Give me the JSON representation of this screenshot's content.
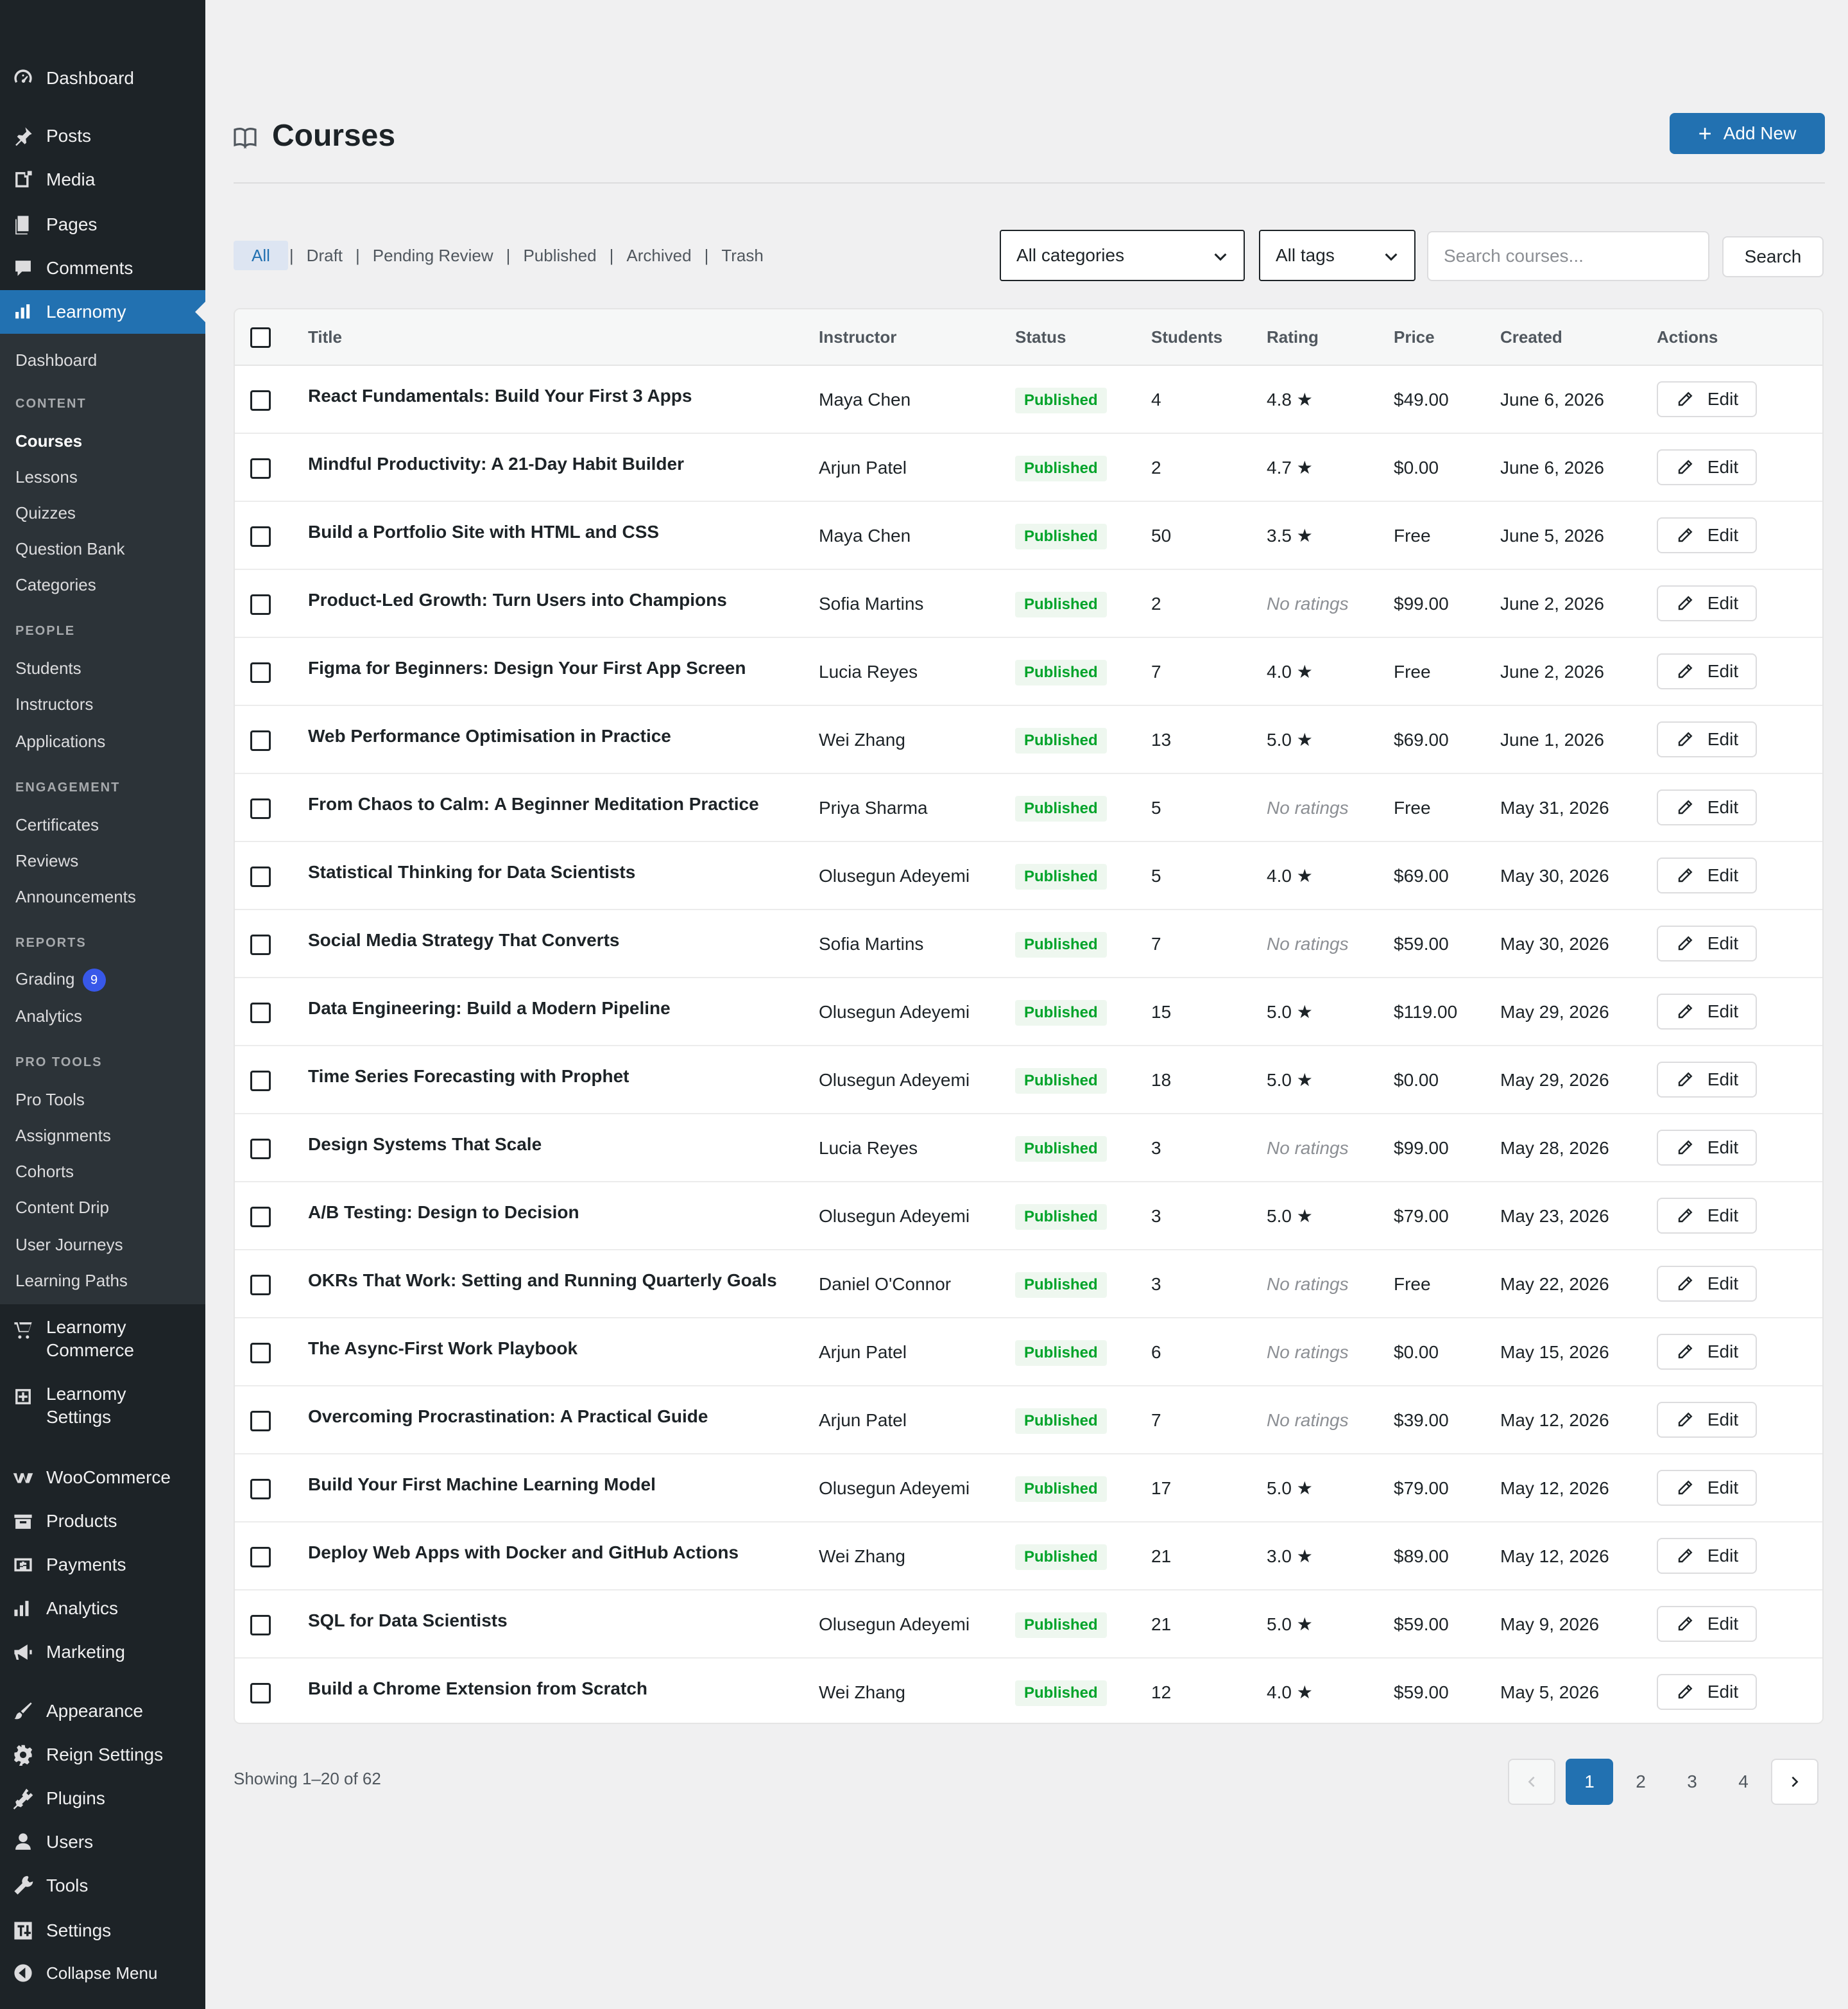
{
  "sidebar": {
    "top_items": [
      {
        "label": "Dashboard",
        "icon": "dashboard-icon"
      },
      {
        "label": "Posts",
        "icon": "pin-icon"
      },
      {
        "label": "Media",
        "icon": "media-icon"
      },
      {
        "label": "Pages",
        "icon": "pages-icon"
      },
      {
        "label": "Comments",
        "icon": "comment-icon"
      }
    ],
    "active_item": {
      "label": "Learnomy",
      "icon": "chart-icon"
    },
    "submenu": {
      "dashboard": "Dashboard",
      "sections": [
        {
          "heading": "CONTENT",
          "items": [
            "Courses",
            "Lessons",
            "Quizzes",
            "Question Bank",
            "Categories"
          ]
        },
        {
          "heading": "PEOPLE",
          "items": [
            "Students",
            "Instructors",
            "Applications"
          ]
        },
        {
          "heading": "ENGAGEMENT",
          "items": [
            "Certificates",
            "Reviews",
            "Announcements"
          ]
        },
        {
          "heading": "REPORTS",
          "items": [
            "Grading",
            "Analytics"
          ]
        },
        {
          "heading": "PRO TOOLS",
          "items": [
            "Pro Tools",
            "Assignments",
            "Cohorts",
            "Content Drip",
            "User Journeys",
            "Learning Paths"
          ]
        }
      ],
      "grading_badge": "9"
    },
    "bottom_items": [
      {
        "label": "Learnomy Commerce",
        "line1": "Learnomy",
        "line2": "Commerce",
        "icon": "cart-icon"
      },
      {
        "label": "Learnomy Settings",
        "line1": "Learnomy",
        "line2": "Settings",
        "icon": "settings-plus-icon"
      },
      {
        "label": "WooCommerce",
        "icon": "woo-icon"
      },
      {
        "label": "Products",
        "icon": "products-icon"
      },
      {
        "label": "Payments",
        "icon": "payments-icon"
      },
      {
        "label": "Analytics",
        "icon": "bar-chart-icon"
      },
      {
        "label": "Marketing",
        "icon": "megaphone-icon"
      },
      {
        "label": "Appearance",
        "icon": "brush-icon"
      },
      {
        "label": "Reign Settings",
        "icon": "gear-icon"
      },
      {
        "label": "Plugins",
        "icon": "plug-icon"
      },
      {
        "label": "Users",
        "icon": "user-icon"
      },
      {
        "label": "Tools",
        "icon": "wrench-icon"
      },
      {
        "label": "Settings",
        "icon": "sliders-icon"
      },
      {
        "label": "Collapse Menu",
        "icon": "collapse-icon"
      }
    ]
  },
  "header": {
    "title": "Courses",
    "add_new": "Add New"
  },
  "filters": {
    "views": [
      "All",
      "Draft",
      "Pending Review",
      "Published",
      "Archived",
      "Trash"
    ],
    "selected_view": "All",
    "category": "All categories",
    "tag": "All tags",
    "search_placeholder": "Search courses...",
    "search_button": "Search"
  },
  "table": {
    "columns": [
      "Title",
      "Instructor",
      "Status",
      "Students",
      "Rating",
      "Price",
      "Created",
      "Actions"
    ],
    "edit_label": "Edit",
    "rows": [
      {
        "title": "React Fundamentals: Build Your First 3 Apps",
        "instructor": "Maya Chen",
        "status": "Published",
        "students": "4",
        "rating": "4.8",
        "price": "$49.00",
        "created": "June 6, 2026"
      },
      {
        "title": "Mindful Productivity: A 21-Day Habit Builder",
        "instructor": "Arjun Patel",
        "status": "Published",
        "students": "2",
        "rating": "4.7",
        "price": "$0.00",
        "created": "June 6, 2026"
      },
      {
        "title": "Build a Portfolio Site with HTML and CSS",
        "instructor": "Maya Chen",
        "status": "Published",
        "students": "50",
        "rating": "3.5",
        "price": "Free",
        "created": "June 5, 2026"
      },
      {
        "title": "Product-Led Growth: Turn Users into Champions",
        "instructor": "Sofia Martins",
        "status": "Published",
        "students": "2",
        "rating": "No ratings",
        "price": "$99.00",
        "created": "June 2, 2026"
      },
      {
        "title": "Figma for Beginners: Design Your First App Screen",
        "instructor": "Lucia Reyes",
        "status": "Published",
        "students": "7",
        "rating": "4.0",
        "price": "Free",
        "created": "June 2, 2026"
      },
      {
        "title": "Web Performance Optimisation in Practice",
        "instructor": "Wei Zhang",
        "status": "Published",
        "students": "13",
        "rating": "5.0",
        "price": "$69.00",
        "created": "June 1, 2026"
      },
      {
        "title": "From Chaos to Calm: A Beginner Meditation Practice",
        "instructor": "Priya Sharma",
        "status": "Published",
        "students": "5",
        "rating": "No ratings",
        "price": "Free",
        "created": "May 31, 2026"
      },
      {
        "title": "Statistical Thinking for Data Scientists",
        "instructor": "Olusegun Adeyemi",
        "status": "Published",
        "students": "5",
        "rating": "4.0",
        "price": "$69.00",
        "created": "May 30, 2026"
      },
      {
        "title": "Social Media Strategy That Converts",
        "instructor": "Sofia Martins",
        "status": "Published",
        "students": "7",
        "rating": "No ratings",
        "price": "$59.00",
        "created": "May 30, 2026"
      },
      {
        "title": "Data Engineering: Build a Modern Pipeline",
        "instructor": "Olusegun Adeyemi",
        "status": "Published",
        "students": "15",
        "rating": "5.0",
        "price": "$119.00",
        "created": "May 29, 2026"
      },
      {
        "title": "Time Series Forecasting with Prophet",
        "instructor": "Olusegun Adeyemi",
        "status": "Published",
        "students": "18",
        "rating": "5.0",
        "price": "$0.00",
        "created": "May 29, 2026"
      },
      {
        "title": "Design Systems That Scale",
        "instructor": "Lucia Reyes",
        "status": "Published",
        "students": "3",
        "rating": "No ratings",
        "price": "$99.00",
        "created": "May 28, 2026"
      },
      {
        "title": "A/B Testing: Design to Decision",
        "instructor": "Olusegun Adeyemi",
        "status": "Published",
        "students": "3",
        "rating": "5.0",
        "price": "$79.00",
        "created": "May 23, 2026"
      },
      {
        "title": "OKRs That Work: Setting and Running Quarterly Goals",
        "instructor": "Daniel O'Connor",
        "status": "Published",
        "students": "3",
        "rating": "No ratings",
        "price": "Free",
        "created": "May 22, 2026"
      },
      {
        "title": "The Async-First Work Playbook",
        "instructor": "Arjun Patel",
        "status": "Published",
        "students": "6",
        "rating": "No ratings",
        "price": "$0.00",
        "created": "May 15, 2026"
      },
      {
        "title": "Overcoming Procrastination: A Practical Guide",
        "instructor": "Arjun Patel",
        "status": "Published",
        "students": "7",
        "rating": "No ratings",
        "price": "$39.00",
        "created": "May 12, 2026"
      },
      {
        "title": "Build Your First Machine Learning Model",
        "instructor": "Olusegun Adeyemi",
        "status": "Published",
        "students": "17",
        "rating": "5.0",
        "price": "$79.00",
        "created": "May 12, 2026"
      },
      {
        "title": "Deploy Web Apps with Docker and GitHub Actions",
        "instructor": "Wei Zhang",
        "status": "Published",
        "students": "21",
        "rating": "3.0",
        "price": "$89.00",
        "created": "May 12, 2026"
      },
      {
        "title": "SQL for Data Scientists",
        "instructor": "Olusegun Adeyemi",
        "status": "Published",
        "students": "21",
        "rating": "5.0",
        "price": "$59.00",
        "created": "May 9, 2026"
      },
      {
        "title": "Build a Chrome Extension from Scratch",
        "instructor": "Wei Zhang",
        "status": "Published",
        "students": "12",
        "rating": "4.0",
        "price": "$59.00",
        "created": "May 5, 2026"
      }
    ]
  },
  "pagination": {
    "showing": "Showing 1–20 of 62",
    "pages": [
      "1",
      "2",
      "3",
      "4"
    ],
    "current": "1"
  },
  "colors": {
    "accent": "#2271b1",
    "sidebar": "#1d2327",
    "status_green": "#00a32a",
    "badge": "#3858e9"
  }
}
